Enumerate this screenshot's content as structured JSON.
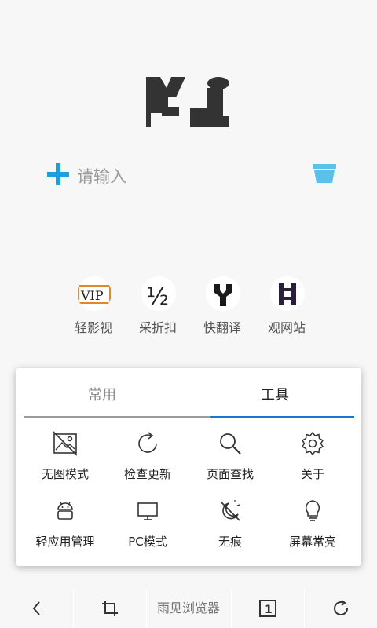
{
  "search": {
    "placeholder": "请输入"
  },
  "shortcuts": [
    {
      "label": "轻影视",
      "icon": "vip-icon",
      "icon_text": "VIP"
    },
    {
      "label": "采折扣",
      "icon": "half-icon",
      "icon_text": "½"
    },
    {
      "label": "快翻译",
      "icon": "translate-icon"
    },
    {
      "label": "观网站",
      "icon": "website-icon"
    }
  ],
  "menu": {
    "tabs": [
      {
        "label": "常用",
        "active": false
      },
      {
        "label": "工具",
        "active": true
      }
    ],
    "tools": [
      {
        "label": "无图模式",
        "icon": "no-image-icon"
      },
      {
        "label": "检查更新",
        "icon": "refresh-icon"
      },
      {
        "label": "页面查找",
        "icon": "search-icon"
      },
      {
        "label": "关于",
        "icon": "gear-icon"
      },
      {
        "label": "轻应用管理",
        "icon": "android-icon"
      },
      {
        "label": "PC模式",
        "icon": "monitor-icon"
      },
      {
        "label": "无痕",
        "icon": "incognito-icon"
      },
      {
        "label": "屏幕常亮",
        "icon": "lightbulb-icon"
      }
    ]
  },
  "bottom_bar": {
    "title": "雨见浏览器",
    "tab_count": "1"
  },
  "colors": {
    "accent": "#1976d2",
    "plus": "#1aa0e0",
    "trash": "#5bc0ea",
    "background": "#f7f7f7"
  }
}
